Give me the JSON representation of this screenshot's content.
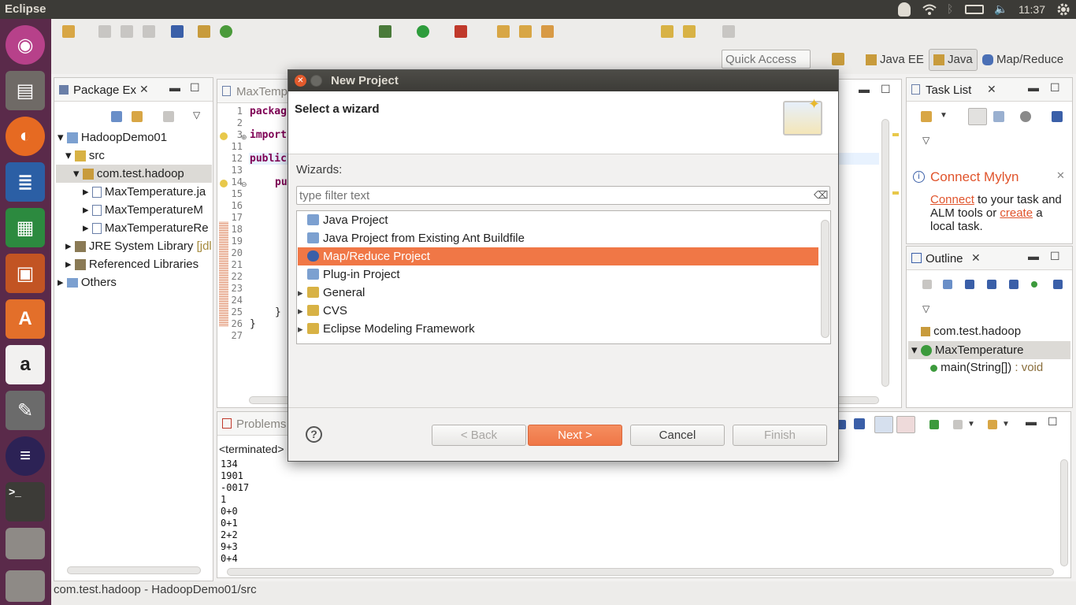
{
  "topbar": {
    "app_title": "Eclipse",
    "clock": "11:37"
  },
  "toolbar": {
    "quick_access_placeholder": "Quick Access",
    "perspectives": [
      "Java EE",
      "Java",
      "Map/Reduce"
    ]
  },
  "package_explorer": {
    "tab": "Package Ex",
    "items": [
      "HadoopDemo01",
      "src",
      "com.test.hadoop",
      "MaxTemperature.ja",
      "MaxTemperatureM",
      "MaxTemperatureRe",
      "JRE System Library",
      "[jdl",
      "Referenced Libraries",
      "Others"
    ]
  },
  "editor": {
    "tab": "MaxTemp",
    "line_numbers": [
      "1",
      "2",
      "3",
      "11",
      "12",
      "13",
      "14",
      "15",
      "16",
      "17",
      "18",
      "19",
      "20",
      "21",
      "22",
      "23",
      "24",
      "25",
      "26",
      "27"
    ],
    "code": [
      "packag",
      "",
      "import",
      "",
      "public",
      "",
      "pu",
      "",
      "",
      "",
      "",
      "",
      "",
      "",
      "",
      "",
      "",
      "}",
      "}",
      ""
    ]
  },
  "tasklist": {
    "tab": "Task List",
    "mylyn_title": "Connect Mylyn",
    "mylyn_link1": "Connect",
    "mylyn_text1": " to your task and",
    "mylyn_text2": "ALM tools or ",
    "mylyn_link2": "create",
    "mylyn_text3": " a",
    "mylyn_text4": "local task."
  },
  "outline": {
    "tab": "Outline",
    "items": [
      "com.test.hadoop",
      "MaxTemperature",
      "main(String[])",
      " : void"
    ]
  },
  "console": {
    "tab": "Problems",
    "header": "<terminated>",
    "lines": [
      "134",
      "1901",
      "-0017",
      "1",
      "0+0",
      "0+1",
      "2+2",
      "9+3",
      "0+4"
    ]
  },
  "status": {
    "text": "com.test.hadoop - HadoopDemo01/src"
  },
  "dialog": {
    "title": "New Project",
    "heading": "Select a wizard",
    "wizards_label": "Wizards:",
    "filter_placeholder": "type filter text",
    "items": [
      "Java Project",
      "Java Project from Existing Ant Buildfile",
      "Map/Reduce Project",
      "Plug-in Project",
      "General",
      "CVS",
      "Eclipse Modeling Framework"
    ],
    "selected_index": 2,
    "buttons": {
      "back": "< Back",
      "next": "Next >",
      "cancel": "Cancel",
      "finish": "Finish"
    },
    "help": "?"
  },
  "colors": {
    "accent": "#f07746",
    "launcher": "#5a2a4a",
    "titlebar": "#3c3b37",
    "link": "#e0542c"
  }
}
